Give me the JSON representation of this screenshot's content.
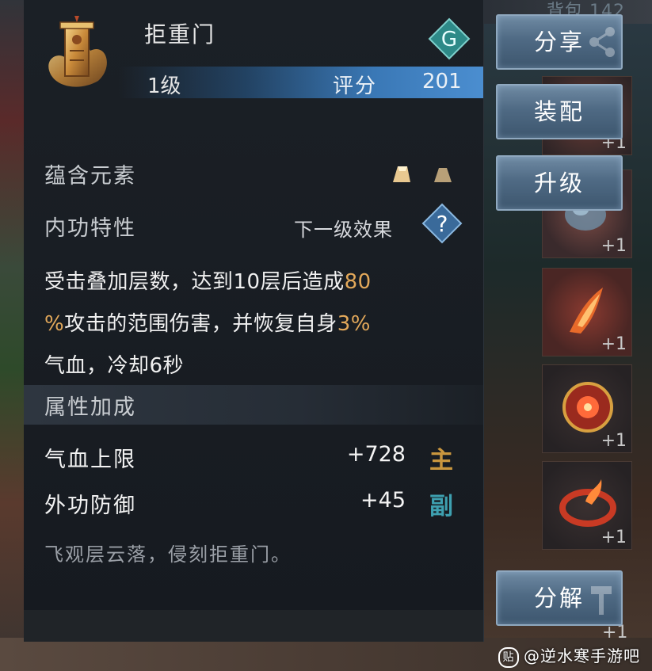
{
  "background": {
    "top_right_text": "背包 142"
  },
  "item": {
    "icon": "door-pillar-badge-icon",
    "name": "拒重门",
    "level": "1级",
    "score_label": "评分",
    "score_value": "201",
    "lock_icon_letter": "G"
  },
  "elements": {
    "label": "蕴含元素",
    "icons": [
      "gold-element-icon",
      "gold-element-icon-dim"
    ]
  },
  "neigong": {
    "label": "内功特性",
    "next_level": "下一级效果",
    "help_icon": "question-mark-icon"
  },
  "description": {
    "line1_text": "受击叠加层数，达到10层后造成",
    "line1_num": "80",
    "line2_num_pct": "%",
    "line2_text": "攻击的范围伤害，并恢复自身",
    "line2_num": "3%",
    "line3_text": "气血，冷却6秒"
  },
  "attributes": {
    "header": "属性加成",
    "rows": [
      {
        "name": "气血上限",
        "value": "+728",
        "tag": "主",
        "tag_color": "#c9963e"
      },
      {
        "name": "外功防御",
        "value": "+45",
        "tag": "副",
        "tag_color": "#3ea0b0"
      }
    ]
  },
  "flavor_text": "飞观层云落，侵刻拒重门。",
  "buttons": {
    "share": "分享",
    "equip": "装配",
    "upgrade": "升级",
    "decompose": "分解"
  },
  "inventory": {
    "slots": [
      {
        "icon": "red-item-icon",
        "count": "+1"
      },
      {
        "icon": "blue-stone-icon",
        "count": "+1"
      },
      {
        "icon": "flame-blade-icon",
        "count": "+1"
      },
      {
        "icon": "red-orb-icon",
        "count": "+1"
      },
      {
        "icon": "fire-ring-icon",
        "count": "+1"
      }
    ],
    "bottom_count": "+1"
  },
  "watermark": {
    "logo": "贴",
    "text": "@逆水寒手游吧"
  },
  "colors": {
    "accent_orange": "#e2a85a",
    "button_blue": "#4f6a84",
    "score_bar": "#3a78b6"
  }
}
